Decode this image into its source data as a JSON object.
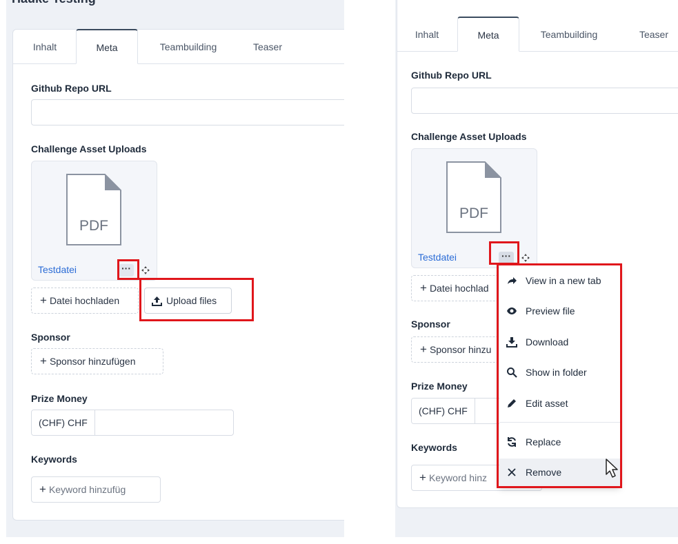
{
  "left": {
    "heading_partial": "Hauke Testing",
    "tabs": [
      {
        "label": "Inhalt"
      },
      {
        "label": "Meta"
      },
      {
        "label": "Teambuilding"
      },
      {
        "label": "Teaser"
      }
    ],
    "github_label": "Github Repo URL",
    "github_value": "",
    "assets_label": "Challenge Asset Uploads",
    "asset_file_type": "PDF",
    "asset_name": "Testdatei",
    "more_button": "···",
    "add_file_label": "Datei hochladen",
    "upload_files_label": "Upload files",
    "sponsor_label": "Sponsor",
    "add_sponsor_label": "Sponsor hinzufügen",
    "prize_label": "Prize Money",
    "prize_currency": "(CHF) CHF",
    "prize_value": "",
    "keywords_label": "Keywords",
    "add_keyword_label": "Keyword hinzufüg"
  },
  "right": {
    "tabs": [
      {
        "label": "Inhalt"
      },
      {
        "label": "Meta"
      },
      {
        "label": "Teambuilding"
      },
      {
        "label": "Teaser"
      }
    ],
    "github_label": "Github Repo URL",
    "assets_label": "Challenge Asset Uploads",
    "asset_file_type": "PDF",
    "asset_name": "Testdatei",
    "more_button": "···",
    "add_file_label": "Datei hochlad",
    "sponsor_label": "Sponsor",
    "add_sponsor_label": "Sponsor hinzu",
    "prize_label": "Prize Money",
    "prize_currency": "(CHF) CHF",
    "keywords_label": "Keywords",
    "add_keyword_label": "Keyword hinz"
  },
  "context_menu": {
    "items": [
      {
        "label": "View in a new tab",
        "icon": "share-arrow-icon"
      },
      {
        "label": "Preview file",
        "icon": "eye-icon"
      },
      {
        "label": "Download",
        "icon": "download-icon"
      },
      {
        "label": "Show in folder",
        "icon": "search-icon"
      },
      {
        "label": "Edit asset",
        "icon": "pencil-icon"
      },
      {
        "label": "Replace",
        "icon": "refresh-icon"
      },
      {
        "label": "Remove",
        "icon": "close-icon"
      }
    ],
    "hovered_item": "Remove"
  },
  "colors": {
    "highlight": "#e0161b",
    "link": "#2b6cd6",
    "background": "#eef1f6"
  }
}
